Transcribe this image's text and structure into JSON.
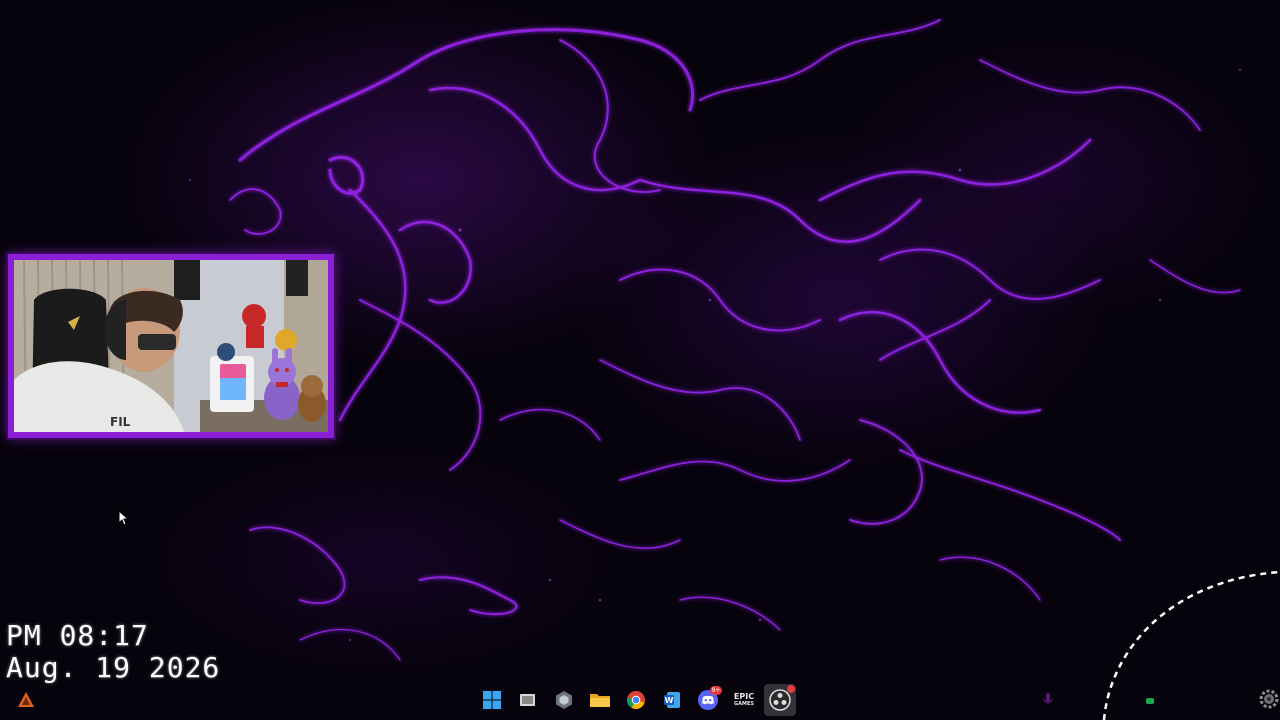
{
  "clock": {
    "time": "PM 08:17",
    "date": "Aug. 19 2026"
  },
  "taskbar": {
    "items": [
      {
        "name": "windows-start",
        "icon": "windows-logo-icon",
        "active": false
      },
      {
        "name": "task-view",
        "icon": "task-view-icon",
        "active": false
      },
      {
        "name": "hex-app",
        "icon": "hexagon-app-icon",
        "active": false
      },
      {
        "name": "file-explorer",
        "icon": "folder-icon",
        "active": false
      },
      {
        "name": "chrome",
        "icon": "chrome-icon",
        "active": false
      },
      {
        "name": "word",
        "icon": "word-icon",
        "label": "W",
        "active": false
      },
      {
        "name": "discord",
        "icon": "discord-icon",
        "badge": "9+",
        "active": false
      },
      {
        "name": "epic-games",
        "icon": "epic-games-icon",
        "label": "EPIC",
        "sublabel": "GAMES",
        "active": false
      },
      {
        "name": "obs",
        "icon": "obs-icon",
        "active": true
      }
    ]
  },
  "colors": {
    "accent": "#8a1fd6",
    "wallpaper_glow": "#9b2cff",
    "background": "#07030d",
    "clock_text": "#ffffff"
  },
  "webcam": {
    "frame_color": "#8a1fd6"
  }
}
